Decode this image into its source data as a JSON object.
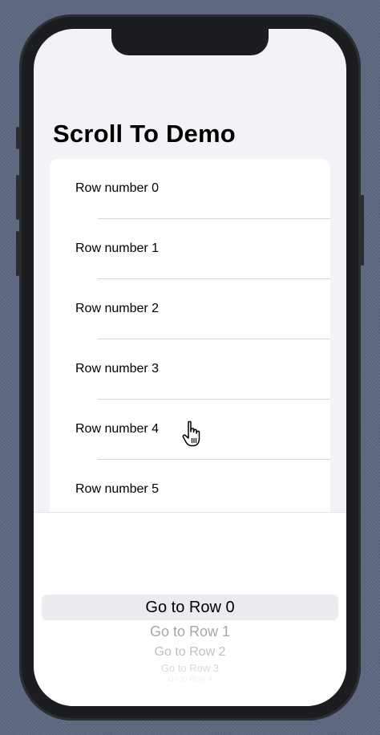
{
  "nav": {
    "title": "Scroll To Demo"
  },
  "list": {
    "rows": [
      {
        "label": "Row number 0"
      },
      {
        "label": "Row number 1"
      },
      {
        "label": "Row number 2"
      },
      {
        "label": "Row number 3"
      },
      {
        "label": "Row number 4"
      },
      {
        "label": "Row number 5"
      }
    ]
  },
  "picker": {
    "selected_label": "Go to Row 0",
    "options": [
      {
        "label": "Go to Row 0"
      },
      {
        "label": "Go to Row 1"
      },
      {
        "label": "Go to Row 2"
      },
      {
        "label": "Go to Row 3"
      },
      {
        "label": "Go to Row 4"
      }
    ]
  },
  "icons": {
    "cursor": "pointing-hand-cursor-icon"
  },
  "colors": {
    "background": "#f2f2f7",
    "card": "#ffffff",
    "text": "#000000"
  }
}
